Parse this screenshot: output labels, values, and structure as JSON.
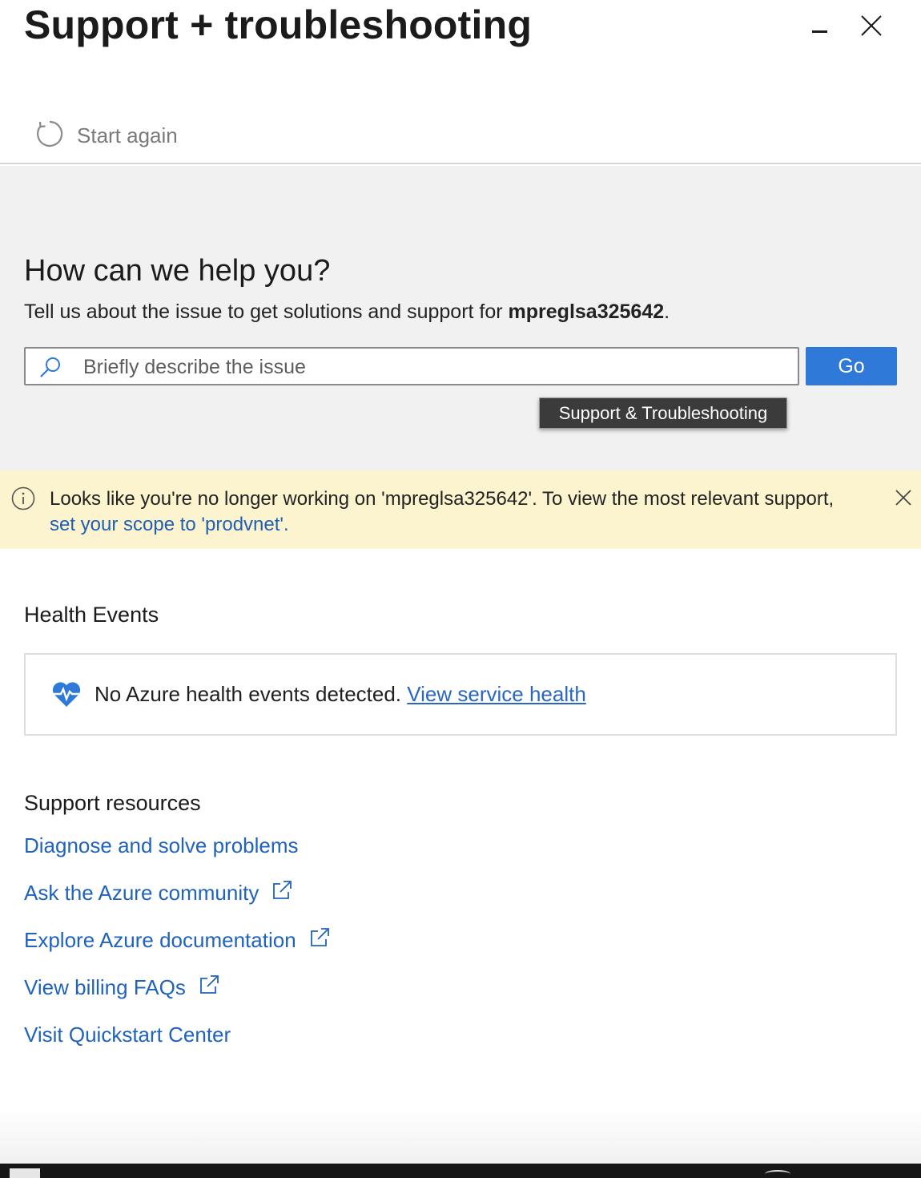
{
  "window": {
    "title": "Support + troubleshooting",
    "minimize_icon": "minimize-icon",
    "close_icon": "close-icon"
  },
  "toolbar": {
    "start_again_label": "Start again",
    "start_again_icon": "refresh-icon"
  },
  "search_section": {
    "heading": "How can we help you?",
    "subtitle_prefix": "Tell us about the issue to get solutions and support for ",
    "resource_name": "mpreglsa325642",
    "subtitle_suffix": ".",
    "search_placeholder": "Briefly describe the issue",
    "search_value": "",
    "go_label": "Go",
    "tooltip": "Support & Troubleshooting"
  },
  "scope_banner": {
    "message": "Looks like you're no longer working on 'mpreglsa325642'. To view the most relevant support,",
    "link_text": "set your scope to 'prodvnet'.",
    "info_icon": "info-icon",
    "dismiss_icon": "close-icon",
    "background_color": "#fcf4cf"
  },
  "health_events": {
    "heading": "Health Events",
    "message": "No Azure health events detected.",
    "link_text": "View service health",
    "icon": "heart-pulse-icon"
  },
  "support_resources": {
    "heading": "Support resources",
    "links": [
      {
        "label": "Diagnose and solve problems",
        "external": false
      },
      {
        "label": "Ask the Azure community",
        "external": true
      },
      {
        "label": "Explore Azure documentation",
        "external": true
      },
      {
        "label": "View billing FAQs",
        "external": true
      },
      {
        "label": "Visit Quickstart Center",
        "external": false
      }
    ]
  },
  "colors": {
    "accent": "#2f79d8",
    "link": "#2063bd",
    "search_area_bg": "#f1f1f1"
  }
}
